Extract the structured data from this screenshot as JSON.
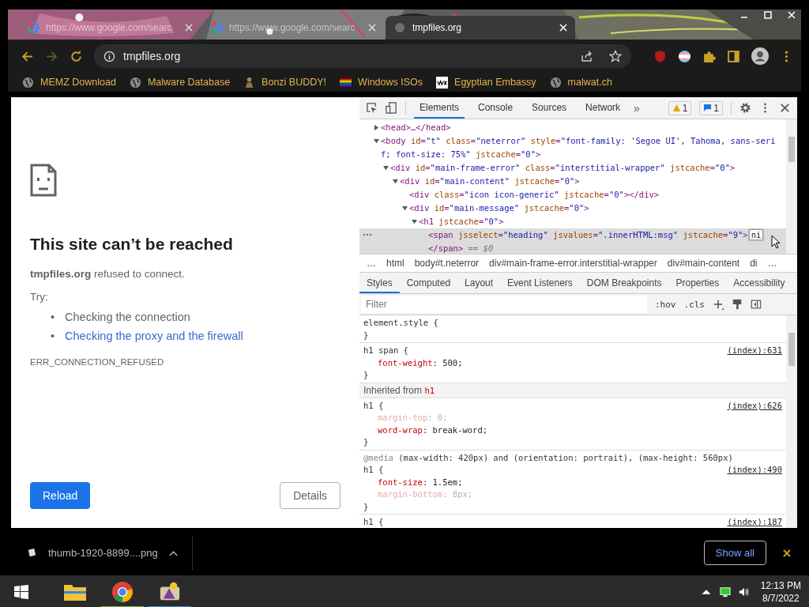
{
  "tabs": [
    {
      "title": "https://www.google.com/searc",
      "selected": false,
      "kind": "google"
    },
    {
      "title": "https://www.google.com/searc",
      "selected": false,
      "kind": "google"
    },
    {
      "title": "tmpfiles.org",
      "selected": true,
      "kind": "blank"
    }
  ],
  "toolbar": {
    "forward_disabled": true,
    "address": "tmpfiles.org"
  },
  "bookmarks": [
    {
      "label": "MEMZ Download",
      "kind": "globe"
    },
    {
      "label": "Malware Database",
      "kind": "globe"
    },
    {
      "label": "Bonzi BUDDY!",
      "kind": "figure"
    },
    {
      "label": "Windows ISOs",
      "kind": "rainbow"
    },
    {
      "label": "Egyptian Embassy",
      "kind": "wix"
    },
    {
      "label": "malwat.ch",
      "kind": "globe"
    }
  ],
  "page": {
    "heading": "This site can’t be reached",
    "message": "**tmpfiles.org** refused to connect.",
    "try_label": "Try:",
    "bullet": "•",
    "suggestions": [
      {
        "text": "Checking the connection",
        "kind": "plain"
      },
      {
        "text": "Checking the proxy and the firewall",
        "kind": "link"
      }
    ],
    "error_code": "ERR_CONNECTION_REFUSED",
    "reload": "Reload",
    "details": "Details"
  },
  "devtools": {
    "tabs": [
      {
        "label": "Elements",
        "selected": true
      },
      {
        "label": "Console",
        "selected": false
      },
      {
        "label": "Sources",
        "selected": false
      },
      {
        "label": "Network",
        "selected": false
      }
    ],
    "more": "»",
    "warnings": "1",
    "messages": "1",
    "dom": [
      {
        "text": "<head>…</head>",
        "expanded": false,
        "selected": false
      },
      {
        "text": "<body id=\"t\" class=\"neterror\" style=\"font-family: 'Segoe UI', Tahoma, sans-serif; font-size: 75%\" jstcache=\"0\">",
        "expanded": true,
        "selected": false,
        "children": [
          {
            "text": "<div id=\"main-frame-error\" class=\"interstitial-wrapper\" jstcache=\"0\">",
            "expanded": true,
            "selected": false,
            "children": [
              {
                "text": "<div id=\"main-content\" jstcache=\"0\">",
                "expanded": true,
                "selected": false,
                "children": [
                  {
                    "text": "<div class=\"icon icon-generic\" jstcache=\"0\"></div>",
                    "selected": false
                  },
                  {
                    "text": "<div id=\"main-message\" jstcache=\"0\">",
                    "expanded": true,
                    "selected": false,
                    "children": [
                      {
                        "text": "<h1 jstcache=\"0\">",
                        "expanded": true,
                        "selected": false,
                        "children": [
                          {
                            "text": "<span jsselect=\"heading\" jsvalues=\".innerHTML:msg\" jstcache=\"9\">",
                            "selected": true,
                            "edit_value": "ni",
                            "closing": "</span>",
                            "marker": "== $0"
                          }
                        ]
                      }
                    ]
                  }
                ]
              }
            ]
          }
        ]
      }
    ],
    "breadcrumbs": [
      "…",
      "html",
      "body#t.neterror",
      "div#main-frame-error.interstitial-wrapper",
      "div#main-content",
      "di",
      "…"
    ],
    "panel_tabs": [
      {
        "label": "Styles",
        "selected": true
      },
      {
        "label": "Computed",
        "selected": false
      },
      {
        "label": "Layout",
        "selected": false
      },
      {
        "label": "Event Listeners",
        "selected": false
      },
      {
        "label": "DOM Breakpoints",
        "selected": false
      },
      {
        "label": "Properties",
        "selected": false
      },
      {
        "label": "Accessibility",
        "selected": false
      }
    ],
    "filter": {
      "placeholder": "Filter"
    },
    "hov": ":hov",
    "cls": ".cls",
    "styles": [
      {
        "kind": "rule",
        "selector": "element.style {",
        "close": "}"
      },
      {
        "kind": "rule",
        "selector": "h1 span {",
        "source": "(index):631",
        "declarations": [
          {
            "text": "font-weight: 500;",
            "overridden": false
          }
        ],
        "close": "}"
      },
      {
        "kind": "inherited",
        "label": "Inherited from",
        "tag": "h1"
      },
      {
        "kind": "rule",
        "selector": "h1 {",
        "source": "(index):626",
        "declarations": [
          {
            "text": "margin-top: 0;",
            "overridden": true
          },
          {
            "text": "word-wrap: break-word;",
            "overridden": false
          }
        ],
        "close": "}"
      },
      {
        "kind": "rule",
        "media_keyword": "@media",
        "media": "(max-width: 420px) and (orientation: portrait), (max-height: 560px)",
        "selector": "h1 {",
        "source": "(index):490",
        "declarations": [
          {
            "text": "font-size: 1.5em;",
            "overridden": false
          },
          {
            "text": "margin-bottom: 8px;",
            "overridden": true
          }
        ],
        "close": "}"
      },
      {
        "kind": "rule",
        "selector": "h1 {",
        "source": "(index):187"
      }
    ]
  },
  "download": {
    "file": "thumb-1920-8899....png",
    "show_all": "Show all"
  },
  "taskbar": {
    "apps": [
      {
        "kind": "explorer"
      },
      {
        "kind": "chrome",
        "color": "#7cb342"
      },
      {
        "kind": "paint",
        "color": "#3d8ee6"
      }
    ],
    "time": "12:13 PM",
    "date": "8/7/2022"
  }
}
